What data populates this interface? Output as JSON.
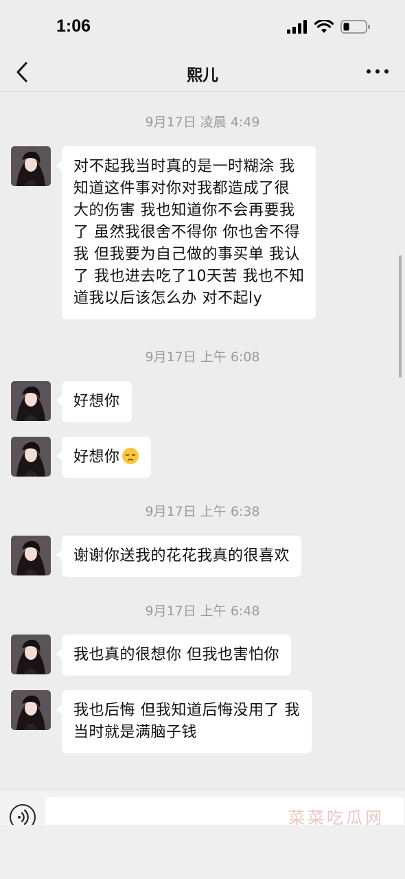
{
  "status_bar": {
    "time": "1:06"
  },
  "header": {
    "title": "熙儿"
  },
  "timestamps": [
    "9月17日 凌晨 4:49",
    "9月17日 上午 6:08",
    "9月17日 上午 6:38",
    "9月17日 上午 6:48"
  ],
  "messages": [
    {
      "lines": [
        "对不起我当时真的是一时糊涂 我",
        "知道这件事对你对我都造成了很",
        "大的伤害 我也知道你不会再要我",
        "了 虽然我很舍不得你 你也舍不得",
        "我 但我要为自己做的事买单 我认",
        "了 我也进去吃了10天苦 我也不知",
        "道我以后该怎么办 对不起ly"
      ]
    },
    {
      "text": "好想你"
    },
    {
      "text": "好想你",
      "emoji": "pensive-face-emoji"
    },
    {
      "text": "谢谢你送我的花花我真的很喜欢"
    },
    {
      "text": "我也真的很想你 但我也害怕你"
    },
    {
      "lines": [
        "我也后悔 但我知道后悔没用了 我",
        "当时就是满脑子钱"
      ]
    }
  ],
  "input_bar": {
    "watermark": "菜菜吃瓜网"
  },
  "icons": {
    "back": "chevron-left-icon",
    "more": "more-dots-icon",
    "voice": "voice-wave-icon",
    "signal": "signal-bars-icon",
    "wifi": "wifi-icon",
    "battery": "battery-icon"
  },
  "colors": {
    "background": "#ededed",
    "bubble": "#ffffff",
    "timestamp": "#9b9b9b"
  }
}
